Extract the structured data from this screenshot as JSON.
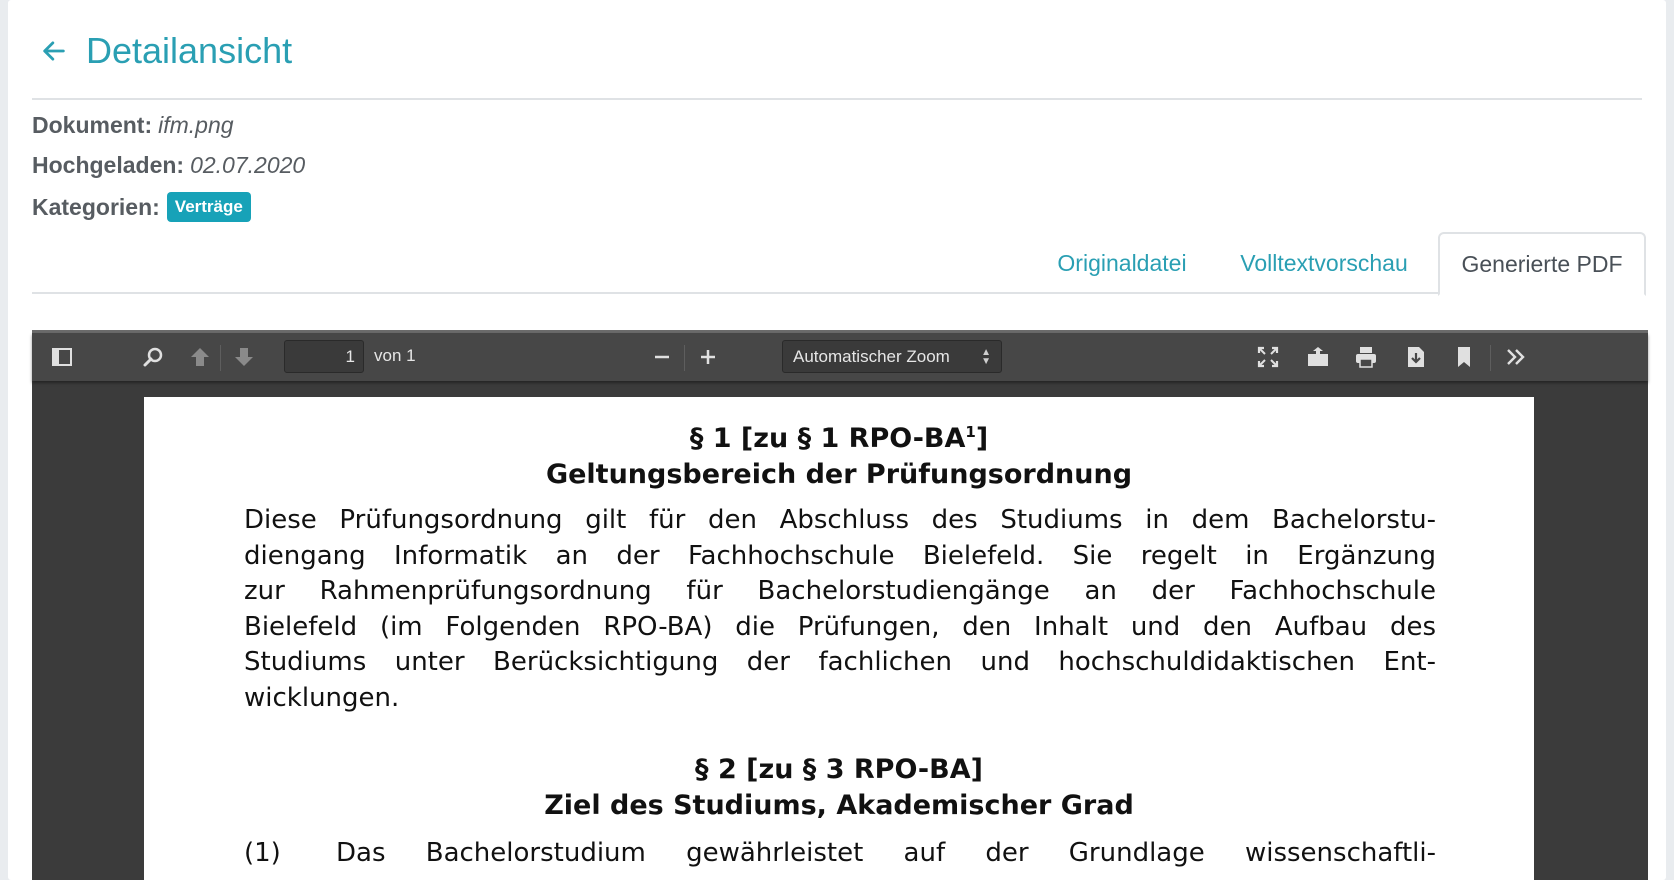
{
  "header": {
    "title": "Detailansicht",
    "back_icon": "arrow-left-icon"
  },
  "meta": {
    "document_label": "Dokument:",
    "document_value": "ifm.png",
    "uploaded_label": "Hochgeladen:",
    "uploaded_value": "02.07.2020",
    "categories_label": "Kategorien:",
    "category_badge": "Verträge"
  },
  "tabs": [
    {
      "label": "Originaldatei",
      "active": false
    },
    {
      "label": "Volltextvorschau",
      "active": false
    },
    {
      "label": "Generierte PDF",
      "active": true
    }
  ],
  "viewer": {
    "toolbar": {
      "page_number": "1",
      "page_of": "von 1",
      "zoom": "Automatischer Zoom",
      "icons": [
        "sidebar-toggle-icon",
        "search-icon",
        "previous-page-icon",
        "next-page-icon",
        "zoom-out-icon",
        "zoom-in-icon",
        "presentation-mode-icon",
        "open-file-icon",
        "print-icon",
        "download-icon",
        "bookmark-icon",
        "tools-icon"
      ]
    },
    "page": {
      "s1_heading": "§ 1 [zu § 1 RPO-BA",
      "s1_sup": "1",
      "s1_heading_end": "]",
      "s1_subtitle": "Geltungsbereich der Prüfungsordnung",
      "s1_lines": [
        "Diese Prüfungsordnung gilt für den Abschluss des Studiums in dem Bachelorstu-",
        "diengang Informatik an der Fachhochschule Bielefeld. Sie regelt in Ergänzung",
        "zur Rahmenprüfungsordnung für Bachelorstudiengänge an der Fachhochschule",
        "Bielefeld (im Folgenden RPO-BA) die Prüfungen, den Inhalt und den Aufbau des",
        "Studiums unter Berücksichtigung der fachlichen und hochschuldidaktischen Ent-",
        "wicklungen."
      ],
      "s2_heading": "§ 2 [zu § 3 RPO-BA]",
      "s2_subtitle": "Ziel des Studiums, Akademischer Grad",
      "s2_p1_num": "(1)",
      "s2_p1_text": "Das Bachelorstudium gewährleistet auf der Grundlage wissenschaftli-"
    }
  },
  "colors": {
    "accent": "#2a9fb3",
    "badge": "#17a2b8",
    "viewer_bg": "#3b3b3b",
    "toolbar_bg": "#474747"
  }
}
